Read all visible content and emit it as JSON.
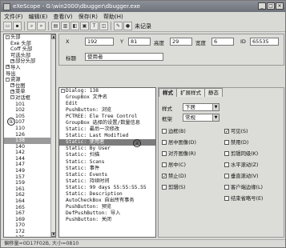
{
  "window": {
    "title": "eXeScope - G:\\win2000\\dbugger\\dbugger.exe",
    "min": "_",
    "max": "□",
    "close": "×"
  },
  "menu": [
    "文件(F)",
    "编辑(E)",
    "查看(V)",
    "保存(R)",
    "帮助(H)"
  ],
  "toolbar": {
    "status_text": "未记录"
  },
  "left_tree": {
    "circle": "①",
    "items": [
      {
        "label": "头部",
        "box": "-",
        "indent": 0
      },
      {
        "label": "Exe 头部",
        "box": "",
        "indent": 1
      },
      {
        "label": "Coff 头部",
        "box": "",
        "indent": 1
      },
      {
        "label": "可选头部",
        "box": "",
        "indent": 1
      },
      {
        "label": "部分头部",
        "box": "+",
        "indent": 1
      },
      {
        "label": "导入",
        "box": "+",
        "indent": 0
      },
      {
        "label": "导出",
        "box": "",
        "indent": 0
      },
      {
        "label": "资源",
        "box": "-",
        "indent": 0
      },
      {
        "label": "位图",
        "box": "+",
        "indent": 1
      },
      {
        "label": "菜单",
        "box": "+",
        "indent": 1
      },
      {
        "label": "对话框",
        "box": "-",
        "indent": 1
      },
      {
        "label": "101",
        "indent": 2
      },
      {
        "label": "102",
        "indent": 2
      },
      {
        "label": "105",
        "indent": 2
      },
      {
        "label": "107",
        "indent": 2
      },
      {
        "label": "110",
        "indent": 2
      },
      {
        "label": "126",
        "indent": 2
      },
      {
        "label": "138",
        "indent": 2,
        "selected": true
      },
      {
        "label": "140",
        "indent": 2
      },
      {
        "label": "142",
        "indent": 2
      },
      {
        "label": "144",
        "indent": 2
      },
      {
        "label": "147",
        "indent": 2
      },
      {
        "label": "149",
        "indent": 2
      },
      {
        "label": "157",
        "indent": 2
      },
      {
        "label": "159",
        "indent": 2
      },
      {
        "label": "161",
        "indent": 2
      },
      {
        "label": "162",
        "indent": 2
      },
      {
        "label": "164",
        "indent": 2
      },
      {
        "label": "165",
        "indent": 2
      },
      {
        "label": "167",
        "indent": 2
      },
      {
        "label": "169",
        "indent": 2
      },
      {
        "label": "170",
        "indent": 2
      },
      {
        "label": "172",
        "indent": 2
      },
      {
        "label": "175",
        "indent": 2
      }
    ]
  },
  "props": {
    "x_label": "X",
    "x_value": "192",
    "y_label": "Y",
    "y_value": "81",
    "height_label": "高度",
    "height_value": "29",
    "width_label": "宽度",
    "width_value": "6",
    "id_label": "ID",
    "id_value": "65535",
    "title_label": "标题",
    "title_value": "使用者"
  },
  "dialog_tree": {
    "circle": "②",
    "root": "Dialog: 138",
    "items": [
      "GroupBox  文件名",
      "Edit",
      "PushButton: 浏览",
      "PCTREE: Ele Tree Control",
      "GroupBox  选择的设置/数量信息",
      "Static: 最后一次修改",
      "Static: Last Modified",
      "Static: 使用者",
      "Static: By User",
      "Static: 扫描",
      "Static: Scans",
      "Static: 事件",
      "Static: Events",
      "Static: 持续时间",
      "Static: 99 days 55:55:55.55",
      "Static: Description",
      "AutoCheckBox  自出所有事务",
      "PushButton: 预览",
      "DefPushButton: 导入",
      "PushButton: 关闭"
    ],
    "selected_index": 7
  },
  "style_panel": {
    "tabs": [
      "样式",
      "扩展样式",
      "静态"
    ],
    "style_label": "样式",
    "style_value": "下居",
    "frame_label": "框架",
    "frame_value": "常规",
    "left_checks": [
      {
        "label": "边框(B)",
        "checked": false
      },
      {
        "label": "居中图像(D)",
        "checked": false
      },
      {
        "label": "对齐图像(R)",
        "checked": false
      },
      {
        "label": "居中(C)",
        "checked": false
      },
      {
        "label": "禁止(D)",
        "checked": true
      },
      {
        "label": "剪辑(S)",
        "checked": false
      }
    ],
    "right_checks": [
      {
        "label": "可见(S)",
        "checked": true
      },
      {
        "label": "禁用(D)",
        "checked": false
      },
      {
        "label": "剪辑同级(K)",
        "checked": false
      },
      {
        "label": "水平滚动(Z)",
        "checked": false
      },
      {
        "label": "垂直滚动(V)",
        "checked": false
      },
      {
        "label": "客户端边缘(L)",
        "checked": false
      },
      {
        "label": "结束省略号(E)",
        "checked": false
      }
    ]
  },
  "status_bar": "偏移量=0D17F02B, 大小=0810"
}
